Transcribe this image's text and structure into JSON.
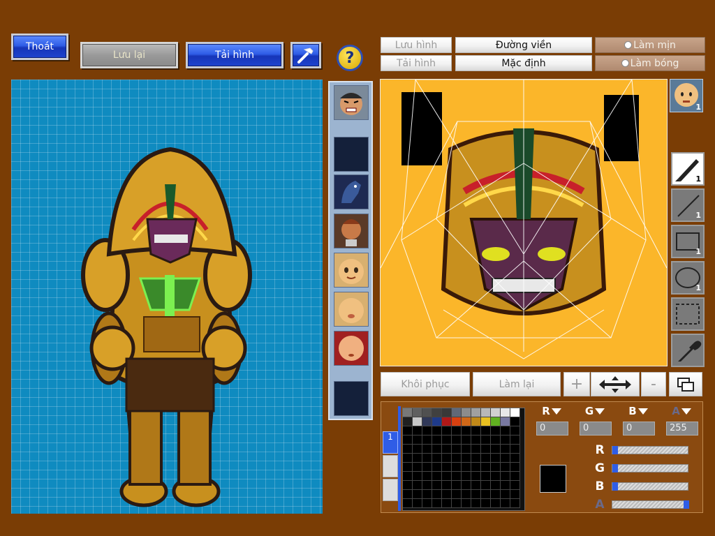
{
  "top_buttons": {
    "exit": "Thoát",
    "save": "Lưu lại",
    "load": "Tải hình",
    "help": "?"
  },
  "editor_header": {
    "save_image": "Lưu hình",
    "load_image": "Tải hình",
    "outline": "Đường viền",
    "default": "Mặc định",
    "smooth": "Làm mịn",
    "shade": "Làm bóng"
  },
  "tools": [
    {
      "name": "pen",
      "count": "1",
      "selected": true
    },
    {
      "name": "line",
      "count": "1",
      "selected": false
    },
    {
      "name": "rectangle",
      "count": "1",
      "selected": false
    },
    {
      "name": "ellipse",
      "count": "1",
      "selected": false
    },
    {
      "name": "selection",
      "count": "",
      "selected": false
    },
    {
      "name": "eyedropper",
      "count": "",
      "selected": false
    }
  ],
  "face_badge": "1",
  "bottom_buttons": {
    "restore": "Khôi phục",
    "redo": "Làm lại",
    "zoom_in": "+",
    "zoom_out": "-"
  },
  "colors": {
    "r_label": "R",
    "g_label": "G",
    "b_label": "B",
    "a_label": "A",
    "r_value": "0",
    "g_value": "0",
    "b_value": "0",
    "a_value": "255",
    "current_color": "#000000"
  },
  "palette": [
    "#787878",
    "#606060",
    "#505050",
    "#404040",
    "#383838",
    "#606878",
    "#8c8c8c",
    "#a0a0a0",
    "#b8b8b8",
    "#d0d0d0",
    "#e8e8e8",
    "#ffffff",
    "#202020",
    "#c8c8c8",
    "#303858",
    "#1e3a8a",
    "#b01818",
    "#d84010",
    "#d06818",
    "#c08818",
    "#e8c020",
    "#60b020",
    "#7878a0"
  ],
  "sliders": {
    "r": 0,
    "g": 0,
    "b": 0,
    "a": 1.0
  },
  "accent": "#2f5de6"
}
